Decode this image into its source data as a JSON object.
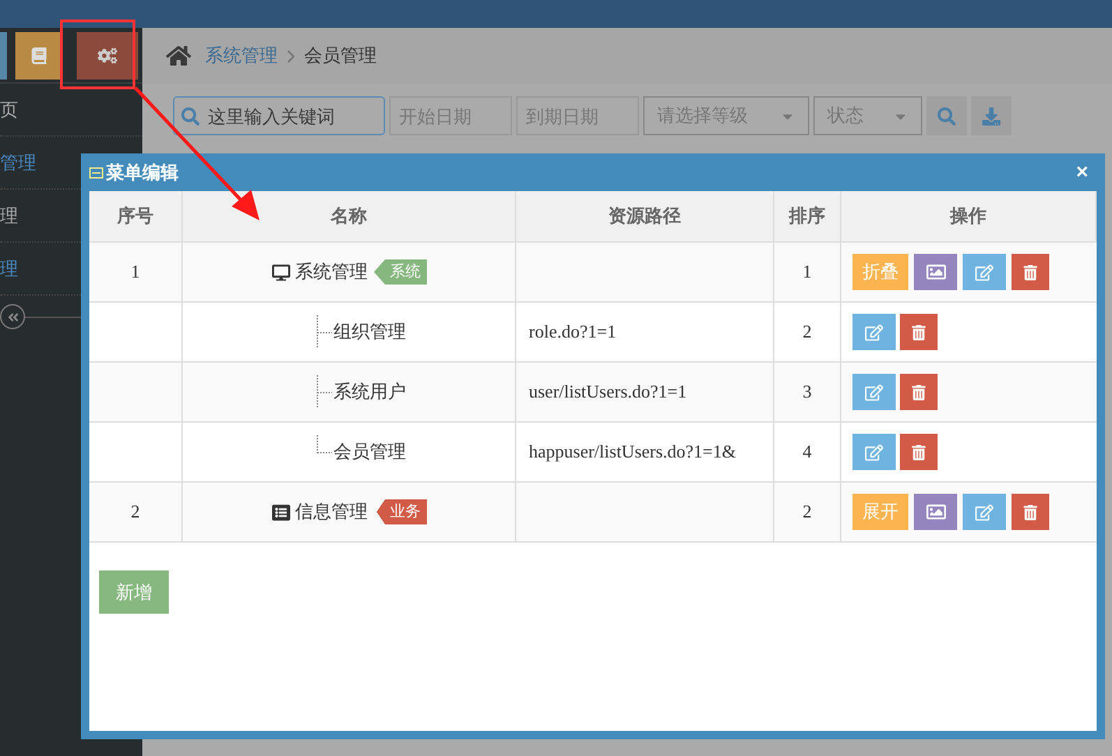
{
  "sidebar": {
    "items": [
      {
        "label": "页",
        "selected": false
      },
      {
        "label": "管理",
        "selected": true
      },
      {
        "label": "理",
        "selected": false
      },
      {
        "label": "理",
        "selected": true
      }
    ]
  },
  "breadcrumb": [
    "系统管理",
    "会员管理"
  ],
  "filters": {
    "search": {
      "placeholder": "这里输入关键词"
    },
    "start_date": {
      "placeholder": "开始日期"
    },
    "end_date": {
      "placeholder": "到期日期"
    },
    "level": {
      "placeholder": "请选择等级"
    },
    "status": {
      "placeholder": "状态"
    }
  },
  "modal": {
    "title": "菜单编辑",
    "close": "×",
    "columns": [
      "序号",
      "名称",
      "资源路径",
      "排序",
      "操作"
    ],
    "rows": [
      {
        "index": "1",
        "name": "系统管理",
        "tag": {
          "text": "系统",
          "kind": "arrow",
          "color": "#86b77e"
        },
        "path": "",
        "order": "1",
        "actions": [
          {
            "kind": "toggle",
            "label": "折叠"
          },
          {
            "kind": "image"
          },
          {
            "kind": "edit"
          },
          {
            "kind": "delete"
          }
        ],
        "children": [
          {
            "name": "组织管理",
            "path": "role.do?1=1",
            "order": "2",
            "actions": [
              {
                "kind": "edit"
              },
              {
                "kind": "delete"
              }
            ]
          },
          {
            "name": "系统用户",
            "path": "user/listUsers.do?1=1",
            "order": "3",
            "actions": [
              {
                "kind": "edit"
              },
              {
                "kind": "delete"
              }
            ]
          },
          {
            "name": "会员管理",
            "path": "happuser/listUsers.do?1=1&",
            "order": "4",
            "actions": [
              {
                "kind": "edit"
              },
              {
                "kind": "delete"
              }
            ]
          }
        ]
      },
      {
        "index": "2",
        "name": "信息管理",
        "tag": {
          "text": "业务",
          "kind": "notch",
          "color": "#d15b47"
        },
        "path": "",
        "order": "2",
        "actions": [
          {
            "kind": "toggle",
            "label": "展开"
          },
          {
            "kind": "image"
          },
          {
            "kind": "edit"
          },
          {
            "kind": "delete"
          }
        ]
      }
    ],
    "add_button": "新增"
  }
}
